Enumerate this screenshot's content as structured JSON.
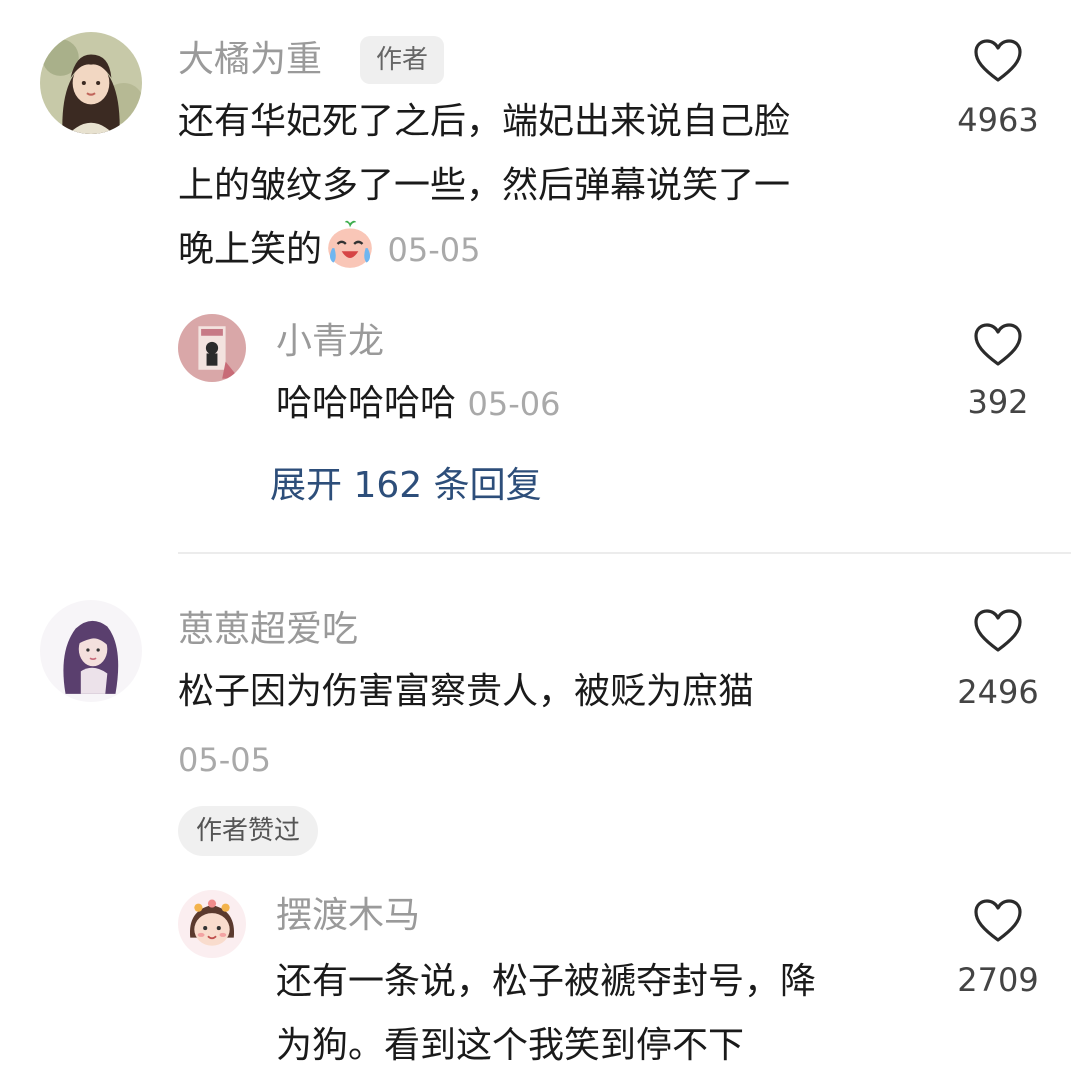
{
  "comments": [
    {
      "username": "大橘为重",
      "author_badge": "作者",
      "lines": [
        "还有华妃死了之后，端妃出来说自己脸",
        "上的皱纹多了一些，然后弹幕说笑了一",
        "晚上笑的"
      ],
      "emoji_icon": "laugh-cry-emoji-icon",
      "date": "05-05",
      "likes": "4963",
      "reply": {
        "username": "小青龙",
        "text": "哈哈哈哈哈",
        "date": "05-06",
        "likes": "392"
      },
      "expand_label": "展开 162 条回复"
    },
    {
      "username": "葸葸超爱吃",
      "lines": [
        "松子因为伤害富察贵人，被贬为庶猫"
      ],
      "date": "05-05",
      "likes": "2496",
      "liked_badge": "作者赞过",
      "reply": {
        "username": "摆渡木马",
        "lines": [
          "还有一条说，松子被褫夺封号，降",
          "为狗。看到这个我笑到停不下"
        ],
        "likes": "2709"
      }
    }
  ],
  "icons": {
    "like": "heart-outline-icon"
  },
  "colors": {
    "username": "#9a9a9a",
    "text": "#1a1a1a",
    "date": "#a9a9a9",
    "link": "#2d4e7a",
    "badge_bg": "#efefef"
  }
}
